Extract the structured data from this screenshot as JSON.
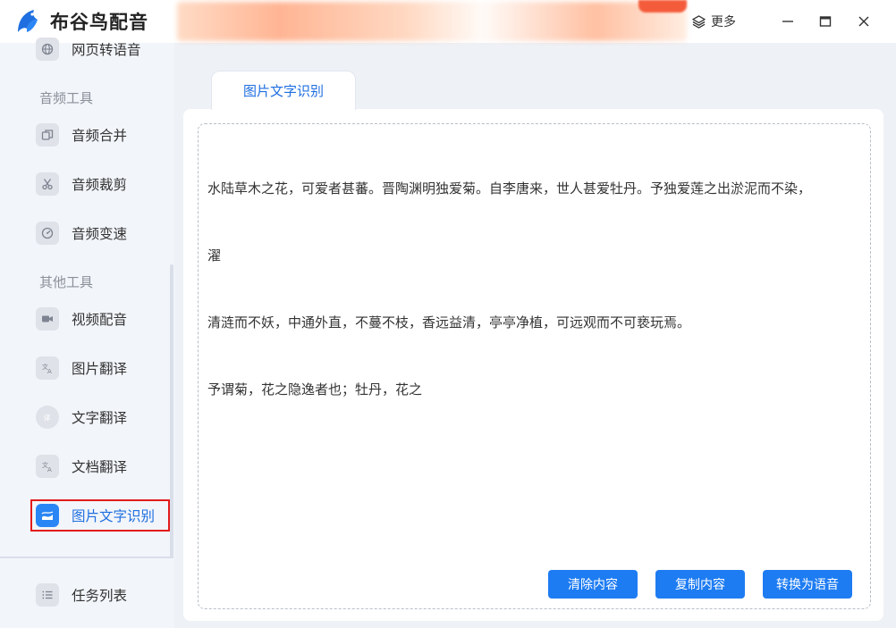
{
  "app": {
    "title": "布谷鸟配音",
    "more_label": "更多"
  },
  "sidebar": {
    "items_top": [
      {
        "label": "网页转语音",
        "icon": "globe-icon"
      }
    ],
    "sections": [
      {
        "label": "音频工具",
        "items": [
          {
            "label": "音频合并",
            "icon": "merge-icon"
          },
          {
            "label": "音频裁剪",
            "icon": "scissors-icon"
          },
          {
            "label": "音频变速",
            "icon": "speed-icon"
          }
        ]
      },
      {
        "label": "其他工具",
        "items": [
          {
            "label": "视频配音",
            "icon": "video-mic-icon"
          },
          {
            "label": "图片翻译",
            "icon": "image-translate-icon"
          },
          {
            "label": "文字翻译",
            "icon": "text-translate-icon"
          },
          {
            "label": "文档翻译",
            "icon": "doc-translate-icon"
          },
          {
            "label": "图片文字识别",
            "icon": "image-ocr-icon",
            "active": true
          }
        ]
      }
    ],
    "bottom_item": {
      "label": "任务列表",
      "icon": "task-list-icon"
    }
  },
  "main": {
    "tab_label": "图片文字识别",
    "text_lines": [
      "水陆草木之花，可爱者甚蕃。晋陶渊明独爱菊。自李唐来，世人甚爱牡丹。予独爱莲之出淤泥而不染，",
      "濯",
      "清涟而不妖，中通外直，不蔓不枝，香远益清，亭亭净植，可远观而不可亵玩焉。",
      "予谓菊，花之隐逸者也；牡丹，花之"
    ],
    "buttons": {
      "clear": "清除内容",
      "copy": "复制内容",
      "convert": "转换为语音"
    }
  },
  "colors": {
    "accent": "#1e7cf2",
    "highlight_border": "#e31b1b"
  }
}
